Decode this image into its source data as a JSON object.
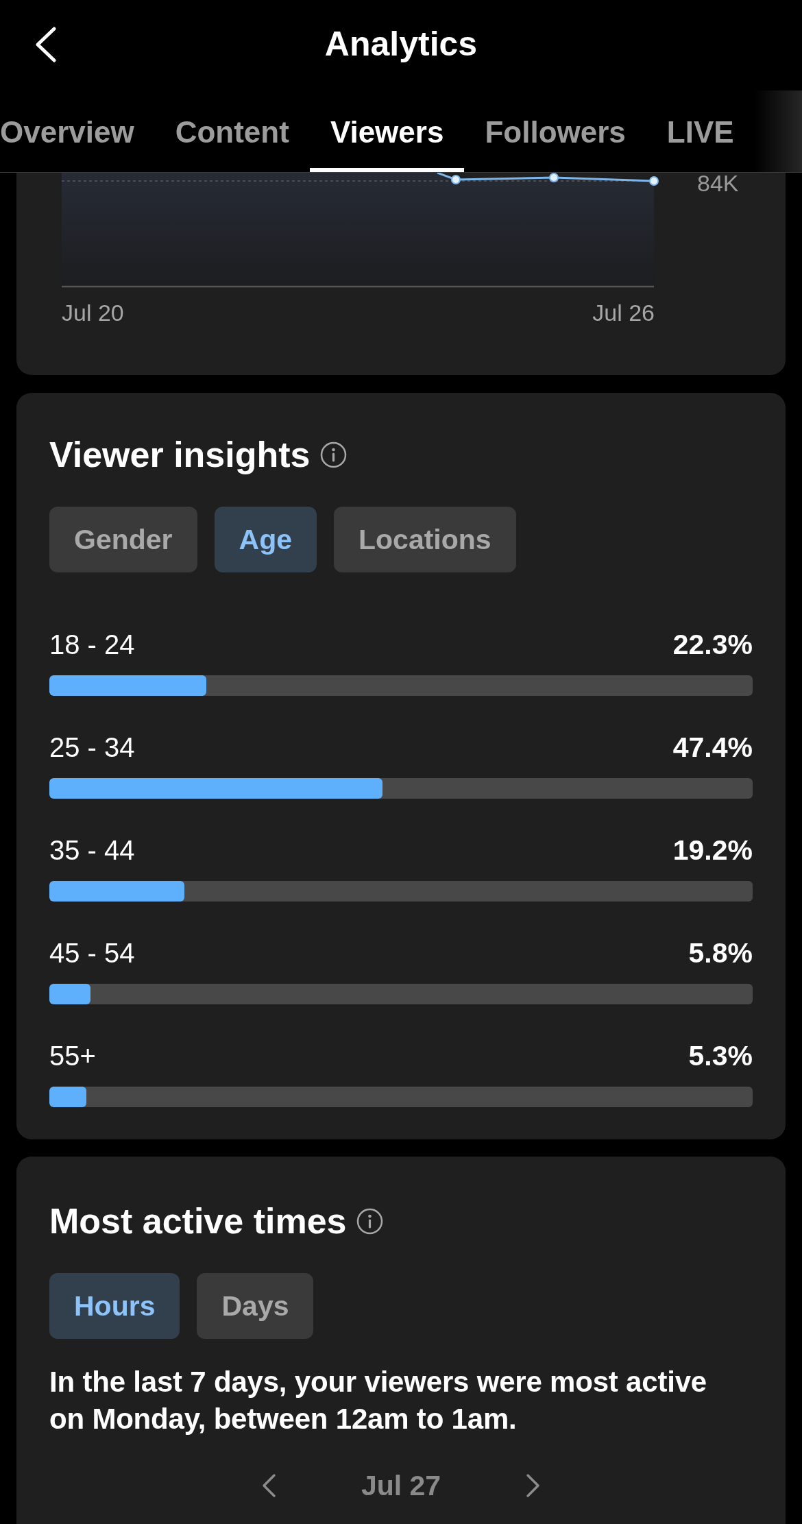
{
  "header": {
    "title": "Analytics"
  },
  "tabs": [
    {
      "label": "Overview",
      "selected": false
    },
    {
      "label": "Content",
      "selected": false
    },
    {
      "label": "Viewers",
      "selected": true
    },
    {
      "label": "Followers",
      "selected": false
    },
    {
      "label": "LIVE",
      "selected": false
    }
  ],
  "views_chart": {
    "y_tick": "84K",
    "x_labels": [
      "Jul 20",
      "Jul 26"
    ]
  },
  "viewer_insights": {
    "title": "Viewer insights",
    "filters": [
      {
        "label": "Gender",
        "selected": false
      },
      {
        "label": "Age",
        "selected": true
      },
      {
        "label": "Locations",
        "selected": false
      }
    ],
    "rows": [
      {
        "label": "18 - 24",
        "value": "22.3%",
        "level": 0.223
      },
      {
        "label": "25 - 34",
        "value": "47.4%",
        "level": 0.474
      },
      {
        "label": "35 - 44",
        "value": "19.2%",
        "level": 0.192
      },
      {
        "label": "45 - 54",
        "value": "5.8%",
        "level": 0.058
      },
      {
        "label": "55+",
        "value": "5.3%",
        "level": 0.053
      }
    ]
  },
  "most_active_times": {
    "title": "Most active times",
    "filters": [
      {
        "label": "Hours",
        "selected": true
      },
      {
        "label": "Days",
        "selected": false
      }
    ],
    "summary": "In the last 7 days, your viewers were most active on Monday, between 12am to 1am.",
    "date": "Jul 27"
  }
}
